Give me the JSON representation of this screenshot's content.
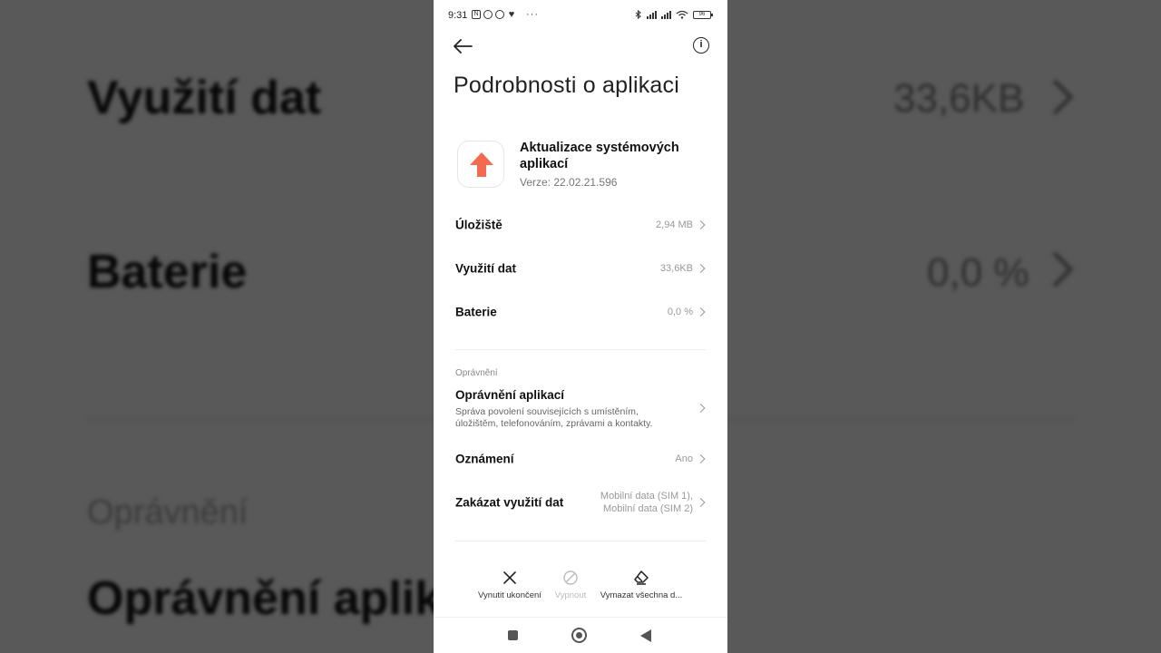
{
  "status_bar": {
    "time": "9:31",
    "battery": "96"
  },
  "header": {
    "title": "Podrobnosti o aplikaci"
  },
  "app": {
    "name": "Aktualizace systémových aplikací",
    "version": "Verze: 22.02.21.596"
  },
  "rows": [
    {
      "label": "Úložiště",
      "value": "2,94 MB"
    },
    {
      "label": "Využití dat",
      "value": "33,6KB"
    },
    {
      "label": "Baterie",
      "value": "0,0 %"
    }
  ],
  "permissions_section": {
    "header": "Oprávnění",
    "title": "Oprávnění aplikací",
    "description": "Správa povolení souvisejících s umístěním, úložištěm, telefonováním, zprávami a kontakty."
  },
  "settings_rows": [
    {
      "label": "Oznámení",
      "value": "Ano"
    },
    {
      "label": "Zakázat využití dat",
      "value_line1": "Mobilní data (SIM 1),",
      "value_line2": "Mobilní data (SIM 2)"
    }
  ],
  "actions": [
    {
      "label": "Vynutit ukončení",
      "icon": "close-icon",
      "enabled": true
    },
    {
      "label": "Vypnout",
      "icon": "disable-icon",
      "enabled": false
    },
    {
      "label": "Vymazat všechna d...",
      "icon": "eraser-icon",
      "enabled": true
    }
  ],
  "background": {
    "row1": "Využití dat",
    "row1_value": "33,6KB",
    "row2": "Baterie",
    "row2_value": "0,0 %",
    "section": "Oprávnění",
    "row3": "Oprávnění aplik"
  },
  "colors": {
    "accent": "#f26b4f",
    "background": "#ffffff"
  }
}
